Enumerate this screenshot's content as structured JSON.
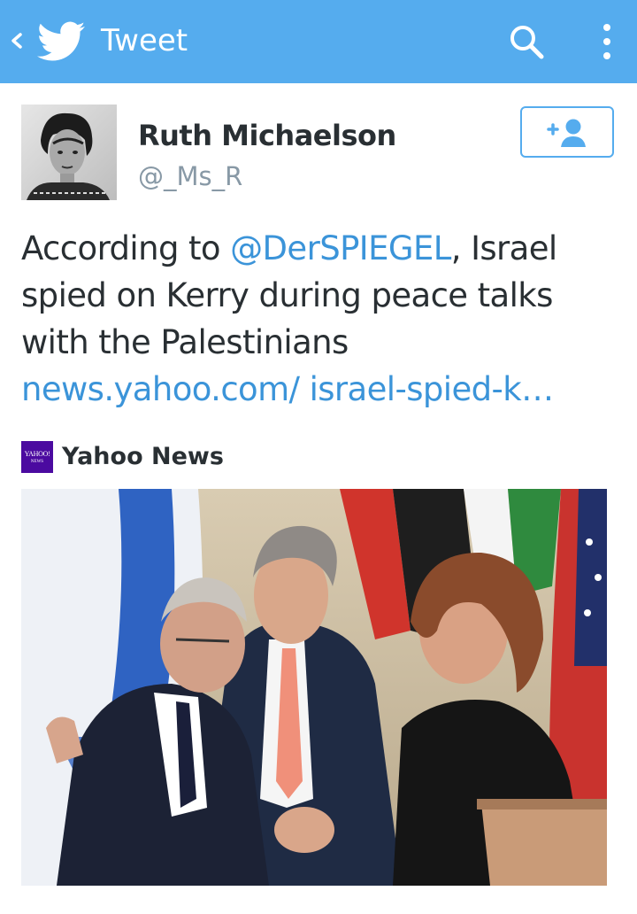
{
  "header": {
    "title": "Tweet",
    "back_icon": "chevron-left-icon",
    "logo_icon": "twitter-bird-icon",
    "search_icon": "search-icon",
    "menu_icon": "more-vertical-icon",
    "bg_color": "#55acee"
  },
  "tweet": {
    "author": {
      "name": "Ruth Michaelson",
      "handle": "@_Ms_R"
    },
    "follow_icon": "add-user-icon",
    "text_segments": [
      {
        "type": "text",
        "value": "According to "
      },
      {
        "type": "mention",
        "value": "@DerSPIEGEL"
      },
      {
        "type": "text",
        "value": ", Israel spied on Kerry during peace talks with the Palestinians  "
      },
      {
        "type": "link",
        "value": "news.yahoo.com/ israel-spied-k…"
      }
    ],
    "card": {
      "source_name": "Yahoo News",
      "source_logo_text": "YAHOO!",
      "source_logo_subtext": "NEWS"
    }
  },
  "colors": {
    "accent": "#55acee",
    "link": "#3b94d9",
    "text": "#292f33",
    "muted": "#8899a6"
  }
}
